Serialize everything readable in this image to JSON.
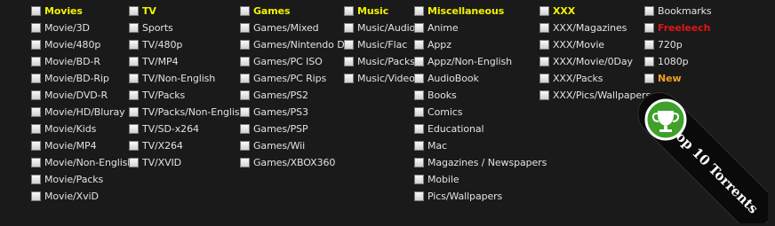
{
  "colors": {
    "header": "#f2f200",
    "freeleech": "#e01515",
    "new": "#f0a01e",
    "badge_bg": "#0a0a0a",
    "badge_green": "#3da12a"
  },
  "columns": [
    {
      "items": [
        "Movies",
        "Movie/3D",
        "Movie/480p",
        "Movie/BD-R",
        "Movie/BD-Rip",
        "Movie/DVD-R",
        "Movie/HD/Bluray",
        "Movie/Kids",
        "Movie/MP4",
        "Movie/Non-English",
        "Movie/Packs",
        "Movie/XviD"
      ]
    },
    {
      "items": [
        "TV",
        "Sports",
        "TV/480p",
        "TV/MP4",
        "TV/Non-English",
        "TV/Packs",
        "TV/Packs/Non-English",
        "TV/SD-x264",
        "TV/X264",
        "TV/XVID"
      ]
    },
    {
      "items": [
        "Games",
        "Games/Mixed",
        "Games/Nintendo DS",
        "Games/PC ISO",
        "Games/PC Rips",
        "Games/PS2",
        "Games/PS3",
        "Games/PSP",
        "Games/Wii",
        "Games/XBOX360"
      ]
    },
    {
      "items": [
        "Music",
        "Music/Audio",
        "Music/Flac",
        "Music/Packs",
        "Music/Video"
      ]
    },
    {
      "items": [
        "Miscellaneous",
        "Anime",
        "Appz",
        "Appz/Non-English",
        "AudioBook",
        "Books",
        "Comics",
        "Educational",
        "Mac",
        "Magazines / Newspapers",
        "Mobile",
        "Pics/Wallpapers"
      ]
    },
    {
      "items": [
        "XXX",
        "XXX/Magazines",
        "XXX/Movie",
        "XXX/Movie/0Day",
        "XXX/Packs",
        "XXX/Pics/Wallpapers"
      ]
    },
    {
      "items": [
        "Bookmarks",
        "Freeleech",
        "720p",
        "1080p",
        "New"
      ]
    }
  ],
  "badge": {
    "text": "Top 10 Torrents",
    "icon": "trophy-icon"
  }
}
